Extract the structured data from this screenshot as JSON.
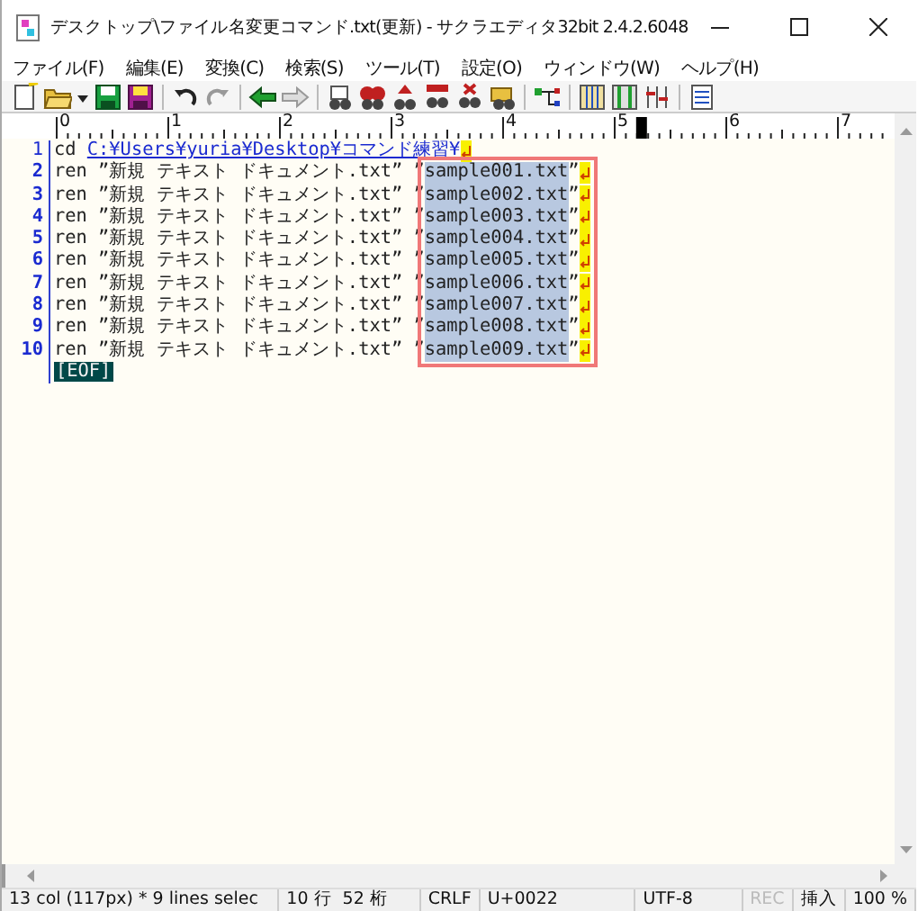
{
  "window": {
    "title": "デスクトップ\\ファイル名変更コマンド.txt(更新) - サクラエディタ32bit 2.4.2.6048"
  },
  "menu": [
    "ファイル(F)",
    "編集(E)",
    "変換(C)",
    "検索(S)",
    "ツール(T)",
    "設定(O)",
    "ウィンドウ(W)",
    "ヘルプ(H)"
  ],
  "ruler": {
    "labels": [
      "0",
      "1",
      "2",
      "3",
      "4",
      "5",
      "6",
      "7"
    ]
  },
  "lines": [
    {
      "number": "1",
      "text": "cd ",
      "link": "C:¥Users¥yuria¥Desktop¥コマンド練習¥"
    },
    {
      "number": "2",
      "text": "ren ”新規 テキスト ドキュメント.txt” ”",
      "selected": "sample001.txt",
      "tail": "”"
    },
    {
      "number": "3",
      "text": "ren ”新規 テキスト ドキュメント.txt” ”",
      "selected": "sample002.txt",
      "tail": "”"
    },
    {
      "number": "4",
      "text": "ren ”新規 テキスト ドキュメント.txt” ”",
      "selected": "sample003.txt",
      "tail": "”"
    },
    {
      "number": "5",
      "text": "ren ”新規 テキスト ドキュメント.txt” ”",
      "selected": "sample004.txt",
      "tail": "”"
    },
    {
      "number": "6",
      "text": "ren ”新規 テキスト ドキュメント.txt” ”",
      "selected": "sample005.txt",
      "tail": "”"
    },
    {
      "number": "7",
      "text": "ren ”新規 テキスト ドキュメント.txt” ”",
      "selected": "sample006.txt",
      "tail": "”"
    },
    {
      "number": "8",
      "text": "ren ”新規 テキスト ドキュメント.txt” ”",
      "selected": "sample007.txt",
      "tail": "”"
    },
    {
      "number": "9",
      "text": "ren ”新規 テキスト ドキュメント.txt” ”",
      "selected": "sample008.txt",
      "tail": "”"
    },
    {
      "number": "10",
      "text": "ren ”新規 テキスト ドキュメント.txt” ”",
      "selected": "sample009.txt",
      "tail": "”"
    }
  ],
  "eof": "[EOF]",
  "status_bar": [
    {
      "text": "13 col (117px) * 9 lines selec",
      "disabled": false
    },
    {
      "text": "10 行  52 桁",
      "disabled": false
    },
    {
      "text": "CRLF",
      "disabled": false
    },
    {
      "text": "U+0022",
      "disabled": false
    },
    {
      "text": "UTF-8",
      "disabled": false
    },
    {
      "text": "REC",
      "disabled": true
    },
    {
      "text": "挿入",
      "disabled": false
    },
    {
      "text": "100 %",
      "disabled": false
    }
  ]
}
